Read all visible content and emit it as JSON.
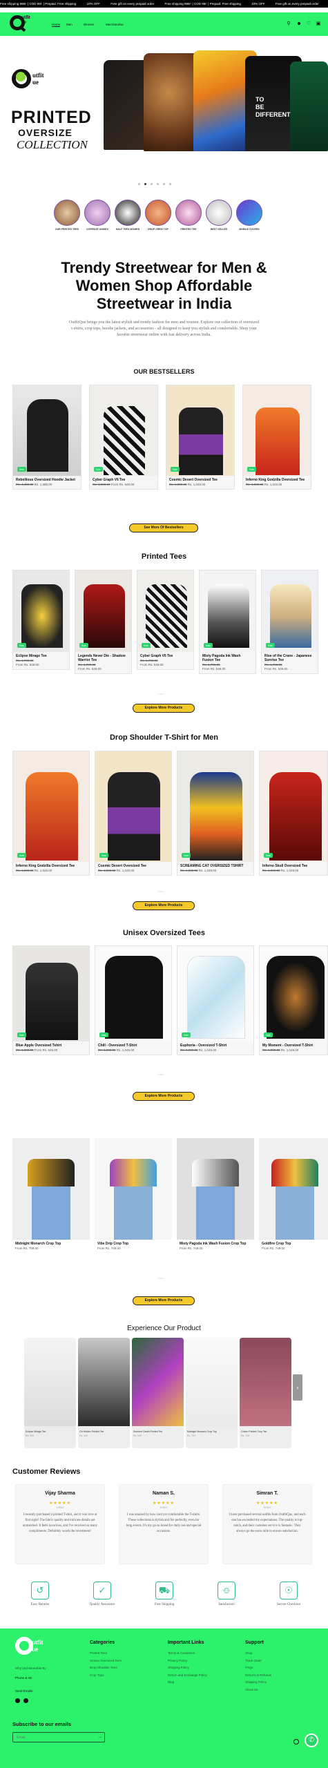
{
  "announcement": {
    "items": [
      "Free shipping 999/- | COD 99/- | Prepaid: Free shipping",
      "10% OFF",
      "Free gift on every prepaid order",
      "Free shipping 999/- | COD 99/- | Prepaid: Free shipping",
      "10% OFF",
      "Free gift on every prepaid order"
    ]
  },
  "header": {
    "logo_text": "utfit\nue",
    "nav": [
      "Home",
      "Men",
      "Women",
      "Merchandise"
    ],
    "icons": [
      "search-icon",
      "user-icon",
      "heart-icon",
      "cart-icon"
    ]
  },
  "hero": {
    "title": "PRINTED",
    "subtitle": "OVERSIZE",
    "collection": "COLLECTION",
    "slide_count": 6,
    "active_slide": 2
  },
  "categories": [
    {
      "label": "OUR PRINTED TEES"
    },
    {
      "label": "OVERSIZE UNISEX"
    },
    {
      "label": "HALF TEES WOMEN"
    },
    {
      "label": "DROP CREW TOP"
    },
    {
      "label": "PRINTED TEE"
    },
    {
      "label": "BEST SELLER"
    },
    {
      "label": "MOBILE COVERS"
    }
  ],
  "intro": {
    "heading": "Trendy Streetwear for Men & Women Shop Affordable Streetwear in India",
    "paragraph": "OutfitQue brings you the latest stylish and trendy fashion for men and women. Explore our collection of oversized t-shirts, crop tops, hoodie jackets, and accessories - all designed to keep you stylish and comfortable. Shop your favorite streetwear online with fast delivery across India."
  },
  "bestsellers": {
    "heading": "OUR BESTSELLERS",
    "badge": "Sale",
    "items": [
      {
        "name": "Rebellious Oversized Hoodie Jacket",
        "price_old": "Rs. 4,499.00",
        "price": "Rs. 1,999.00"
      },
      {
        "name": "Cyber Graph V6 Tee",
        "price_old": "Rs. 1,999.00",
        "price": "From Rs. 649.00"
      },
      {
        "name": "Cosmic Desert Oversized Tee",
        "price_old": "Rs. 1,999.00",
        "price": "Rs. 1,049.00"
      },
      {
        "name": "Inferno King Godzilla Oversized Tee",
        "price_old": "Rs. 1,999.00",
        "price": "Rs. 1,049.00"
      }
    ],
    "button": "See More Of Bestsellers"
  },
  "printed_tees": {
    "heading": "Printed Tees",
    "items": [
      {
        "name": "Eclipse Mirage Tee",
        "price_old": "Rs. 1,799.00",
        "price": "From Rs. 549.00"
      },
      {
        "name": "Legends Never Die - Shadow Warrior Tee",
        "price_old": "Rs. 1,799.00",
        "price": "From Rs. 549.00"
      },
      {
        "name": "Cyber Graph V6 Tee",
        "price_old": "Rs. 1,799.00",
        "price": "From Rs. 549.00"
      },
      {
        "name": "Misty Pagoda Ink Wash Fusion Tee",
        "price_old": "Rs. 1,799.00",
        "price": "From Rs. 549.00"
      },
      {
        "name": "Rise of the Crane - Japanese Sunrise Tee",
        "price_old": "Rs. 1,799.00",
        "price": "From Rs. 549.00"
      }
    ],
    "button": "Explore More Products"
  },
  "drop_shoulder": {
    "heading": "Drop Shoulder T-Shirt for Men",
    "items": [
      {
        "name": "Inferno King Godzilla Oversized Tee",
        "price_old": "Rs. 1,999.00",
        "price": "Rs. 1,049.00"
      },
      {
        "name": "Cosmic Desert Oversized Tee",
        "price_old": "Rs. 1,999.00",
        "price": "Rs. 1,049.00"
      },
      {
        "name": "SCREAMING CAT OVERSIZED TSHIRT",
        "price_old": "Rs. 1,999.00",
        "price": "Rs. 1,049.00"
      },
      {
        "name": "Inferno Skull Oversized Tee",
        "price_old": "Rs. 1,999.00",
        "price": "Rs. 1,049.00"
      }
    ],
    "button": "Explore More Products"
  },
  "unisex": {
    "heading": "Unisex Oversized Tees",
    "items": [
      {
        "name": "Blue Apple Oversized Tshirt",
        "price_old": "Rs. 1,999.00",
        "price": "From Rs. 649.00"
      },
      {
        "name": "Chill - Oversized T-Shirt",
        "price_old": "Rs. 1,999.00",
        "price": "Rs. 1,049.00"
      },
      {
        "name": "Euphoria - Oversized T-Shirt",
        "price_old": "Rs. 1,999.00",
        "price": "Rs. 1,049.00"
      },
      {
        "name": "My Moment - Oversized T-Shirt",
        "price_old": "Rs. 1,999.00",
        "price": "Rs. 1,049.00"
      }
    ],
    "button": "Explore More Products"
  },
  "crop_tops": {
    "items": [
      {
        "name": "Midnight Monarch Crop Top",
        "price": "From Rs. 799.00"
      },
      {
        "name": "Vibe Drip Crop Top",
        "price": "From Rs. 749.00"
      },
      {
        "name": "Misty Pagoda Ink Wash Fusion Crop Top",
        "price": "From Rs. 749.00"
      },
      {
        "name": "Goldfire Crop Top",
        "price": "From Rs. 749.00"
      }
    ],
    "button": "Explore More Products"
  },
  "experience": {
    "heading": "Experience Our Product",
    "videos": [
      {
        "name": "Eclipse Mirage Tee",
        "price": "Rs. 549"
      },
      {
        "name": "Oh Hidden Printed Tee",
        "price": "Rs. 549"
      },
      {
        "name": "Summer Death Printed Tee",
        "price": "Rs. 549"
      },
      {
        "name": "Midnight Monarch Crop Top",
        "price": "Rs. 799"
      },
      {
        "name": "Cotton Printed Crop Tee",
        "price": "Rs. 749"
      }
    ]
  },
  "reviews": {
    "heading": "Customer Reviews",
    "items": [
      {
        "name": "Vijay Sharma",
        "stars": "★★★★★",
        "score": "4.8/5.0",
        "text": "I recently purchased a printed T-shirt, and it was love at first sight! The fabric quality and intricate details are unmatched. It feels luxurious, and I've received so many compliments. Definitely worth the investment!"
      },
      {
        "name": "Naman S.",
        "stars": "★★★★★",
        "score": "5.0/5.0",
        "text": "I was amazed by how cool yet comfortable the T-shirts. These collections is stylish and fits perfectly, even for long events. It's my go-to brand for daily use and special occasions."
      },
      {
        "name": "Simran T.",
        "stars": "★★★★★",
        "score": "5.0/5.0",
        "text": "I have purchased several outfits from OutfitQue, and each one has exceeded my expectations. The quality is top-notch, and their customer service is fantastic. They always go the extra mile to ensure satisfaction."
      }
    ]
  },
  "features": [
    {
      "label": "Easy Returns",
      "icon": "return-box-icon"
    },
    {
      "label": "Quality Assurance",
      "icon": "quality-badge-icon"
    },
    {
      "label": "Free Shipping",
      "icon": "truck-icon"
    },
    {
      "label": "Satisfaction",
      "icon": "satisfaction-icon"
    },
    {
      "label": "Secure Checkout",
      "icon": "lock-cart-icon"
    }
  ],
  "footer": {
    "tagline": "Why and Wearable By",
    "phone_label": "Phone & etc",
    "email_label": "Send Emails",
    "categories": {
      "heading": "Categories",
      "items": [
        "Printed Tees",
        "Unisex Oversized Tees",
        "Drop Shoulder Tees",
        "Crop Tops"
      ]
    },
    "important": {
      "heading": "Important Links",
      "items": [
        "Terms & Conditions",
        "Privacy Policy",
        "Shipping Policy",
        "Return and Exchange Policy",
        "Blog"
      ]
    },
    "support": {
      "heading": "Support",
      "items": [
        "Shop",
        "Track Order",
        "FAQs",
        "Returns & Refunds",
        "Shipping Policy",
        "About Us"
      ]
    },
    "subscribe_heading": "Subscribe to our emails",
    "email_placeholder": "Email",
    "colors": {
      "brand_green": "#2cf26b",
      "accent_yellow": "#f6c92b",
      "sale_badge": "#2bd46a"
    }
  }
}
